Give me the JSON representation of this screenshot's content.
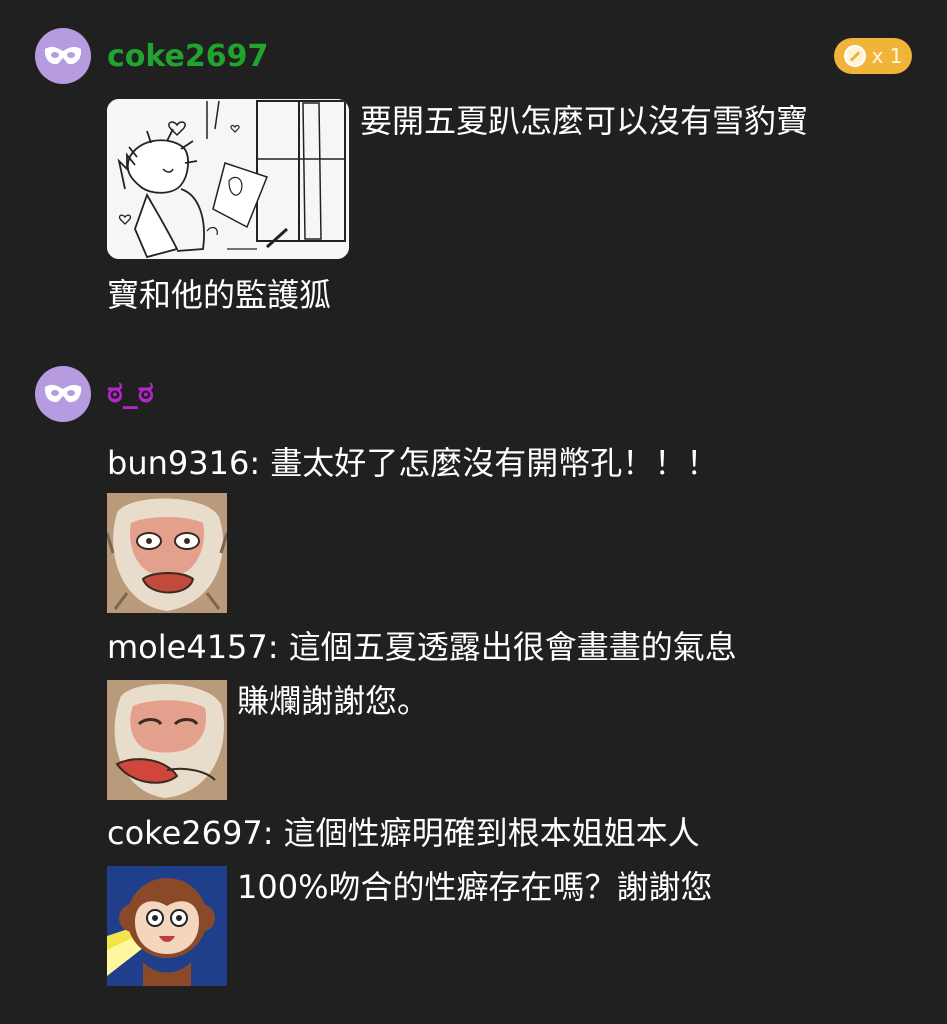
{
  "posts": [
    {
      "username": "coke2697",
      "username_color": "#21a32f",
      "avatar_icon": "mask-icon",
      "badge": {
        "icon": "coin-icon",
        "count": "x 1"
      },
      "image_icon": "manga-sketch-image",
      "text_line1": "要開五夏趴怎麼可以沒有雪豹寶",
      "text_line2": "寶和他的監護狐"
    },
    {
      "username": "ಠ_ಠ",
      "username_color": "#b326c9",
      "avatar_icon": "mask-icon",
      "comments": [
        {
          "line": "bun9316: 畫太好了怎麼沒有開幣孔！！！",
          "sticker": "monkey-sticker-1"
        },
        {
          "line": "mole4157: 這個五夏透露出很會畫畫的氣息",
          "sticker": "monkey-sticker-2",
          "continuation": "賺爛謝謝您。"
        },
        {
          "line": "coke2697: 這個性癖明確到根本姐姐本人",
          "sticker": "monkey-sticker-3",
          "continuation": "100%吻合的性癖存在嗎？謝謝您"
        }
      ]
    }
  ]
}
